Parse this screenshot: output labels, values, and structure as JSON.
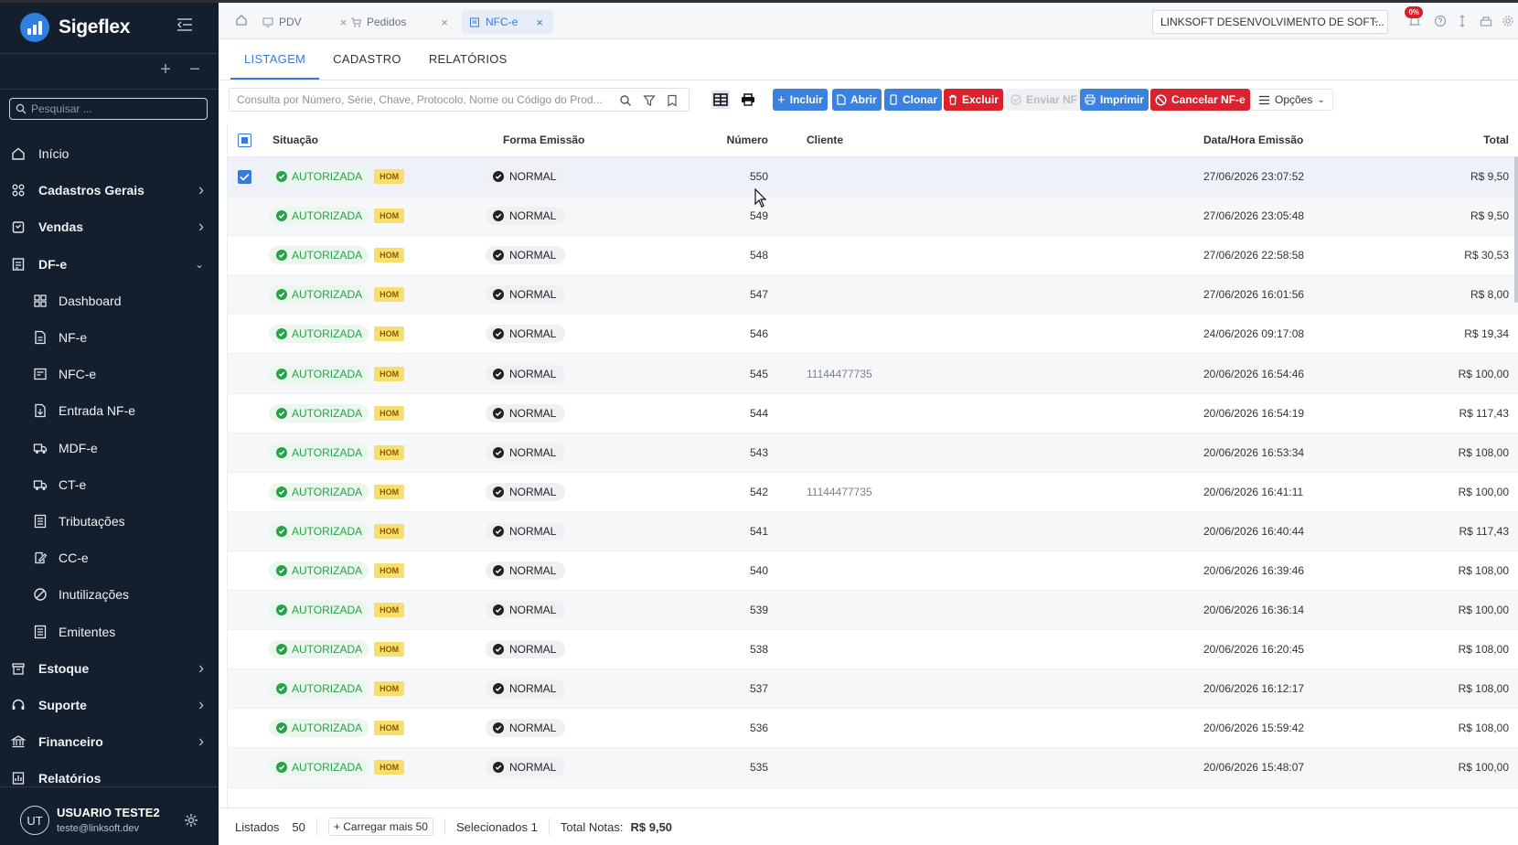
{
  "app": {
    "name": "Sigeflex"
  },
  "sidebar": {
    "search_placeholder": "Pesquisar ...",
    "items": [
      {
        "label": "Início",
        "icon": "home-icon",
        "level": "top",
        "chevron": ""
      },
      {
        "label": "Cadastros Gerais",
        "icon": "grid-icon",
        "level": "top",
        "chevron": "›"
      },
      {
        "label": "Vendas",
        "icon": "cart-icon",
        "level": "top",
        "chevron": "›"
      },
      {
        "label": "DF-e",
        "icon": "document-icon",
        "level": "top",
        "chevron": "⌄"
      },
      {
        "label": "Dashboard",
        "icon": "dashboard-icon",
        "level": "sub",
        "chevron": ""
      },
      {
        "label": "NF-e",
        "icon": "file-icon",
        "level": "sub",
        "chevron": ""
      },
      {
        "label": "NFC-e",
        "icon": "receipt-icon",
        "level": "sub",
        "chevron": ""
      },
      {
        "label": "Entrada NF-e",
        "icon": "file-in-icon",
        "level": "sub",
        "chevron": ""
      },
      {
        "label": "MDF-e",
        "icon": "truck-icon",
        "level": "sub",
        "chevron": ""
      },
      {
        "label": "CT-e",
        "icon": "truck-icon",
        "level": "sub",
        "chevron": ""
      },
      {
        "label": "Tributações",
        "icon": "tax-icon",
        "level": "sub",
        "chevron": ""
      },
      {
        "label": "CC-e",
        "icon": "edit-doc-icon",
        "level": "sub",
        "chevron": ""
      },
      {
        "label": "Inutilizações",
        "icon": "ban-icon",
        "level": "sub",
        "chevron": ""
      },
      {
        "label": "Emitentes",
        "icon": "list-icon",
        "level": "sub",
        "chevron": ""
      },
      {
        "label": "Estoque",
        "icon": "box-icon",
        "level": "top",
        "chevron": "›"
      },
      {
        "label": "Suporte",
        "icon": "headset-icon",
        "level": "top",
        "chevron": "›"
      },
      {
        "label": "Financeiro",
        "icon": "bank-icon",
        "level": "top",
        "chevron": "›"
      },
      {
        "label": "Relatórios",
        "icon": "report-icon",
        "level": "top",
        "chevron": ""
      }
    ],
    "user": {
      "initials": "UT",
      "name": "USUARIO TESTE2",
      "email": "teste@linksoft.dev"
    }
  },
  "topbar": {
    "tabs": [
      {
        "label": "PDV",
        "icon": "monitor-icon"
      },
      {
        "label": "Pedidos",
        "icon": "cart-icon"
      },
      {
        "label": "NFC-e",
        "icon": "receipt-icon"
      }
    ],
    "company": "LINKSOFT DESENVOLVIMENTO DE SOFT...",
    "notification_badge": "0%"
  },
  "subtabs": [
    "LISTAGEM",
    "CADASTRO",
    "RELATÓRIOS"
  ],
  "toolbar": {
    "search_placeholder": "Consulta por Número, Série, Chave, Protocolo, Nome ou Código do Prod...",
    "buttons": {
      "incluir": "Incluir",
      "abrir": "Abrir",
      "clonar": "Clonar",
      "excluir": "Excluir",
      "enviar": "Enviar NF",
      "imprimir": "Imprimir",
      "cancelar": "Cancelar NF-e",
      "opcoes": "Opções"
    }
  },
  "table": {
    "headers": {
      "situacao": "Situação",
      "forma": "Forma Emissão",
      "numero": "Número",
      "cliente": "Cliente",
      "data": "Data/Hora Emissão",
      "total": "Total"
    },
    "rows": [
      {
        "situacao": "AUTORIZADA",
        "env": "HOM",
        "forma": "NORMAL",
        "numero": "550",
        "cliente": "",
        "data": "27/06/2026 23:07:52",
        "total": "R$ 9,50"
      },
      {
        "situacao": "AUTORIZADA",
        "env": "HOM",
        "forma": "NORMAL",
        "numero": "549",
        "cliente": "",
        "data": "27/06/2026 23:05:48",
        "total": "R$ 9,50"
      },
      {
        "situacao": "AUTORIZADA",
        "env": "HOM",
        "forma": "NORMAL",
        "numero": "548",
        "cliente": "",
        "data": "27/06/2026 22:58:58",
        "total": "R$ 30,53"
      },
      {
        "situacao": "AUTORIZADA",
        "env": "HOM",
        "forma": "NORMAL",
        "numero": "547",
        "cliente": "",
        "data": "27/06/2026 16:01:56",
        "total": "R$ 8,00"
      },
      {
        "situacao": "AUTORIZADA",
        "env": "HOM",
        "forma": "NORMAL",
        "numero": "546",
        "cliente": "",
        "data": "24/06/2026 09:17:08",
        "total": "R$ 19,34"
      },
      {
        "situacao": "AUTORIZADA",
        "env": "HOM",
        "forma": "NORMAL",
        "numero": "545",
        "cliente": "11144477735",
        "data": "20/06/2026 16:54:46",
        "total": "R$ 100,00"
      },
      {
        "situacao": "AUTORIZADA",
        "env": "HOM",
        "forma": "NORMAL",
        "numero": "544",
        "cliente": "",
        "data": "20/06/2026 16:54:19",
        "total": "R$ 117,43"
      },
      {
        "situacao": "AUTORIZADA",
        "env": "HOM",
        "forma": "NORMAL",
        "numero": "543",
        "cliente": "",
        "data": "20/06/2026 16:53:34",
        "total": "R$ 108,00"
      },
      {
        "situacao": "AUTORIZADA",
        "env": "HOM",
        "forma": "NORMAL",
        "numero": "542",
        "cliente": "11144477735",
        "data": "20/06/2026 16:41:11",
        "total": "R$ 100,00"
      },
      {
        "situacao": "AUTORIZADA",
        "env": "HOM",
        "forma": "NORMAL",
        "numero": "541",
        "cliente": "",
        "data": "20/06/2026 16:40:44",
        "total": "R$ 117,43"
      },
      {
        "situacao": "AUTORIZADA",
        "env": "HOM",
        "forma": "NORMAL",
        "numero": "540",
        "cliente": "",
        "data": "20/06/2026 16:39:46",
        "total": "R$ 108,00"
      },
      {
        "situacao": "AUTORIZADA",
        "env": "HOM",
        "forma": "NORMAL",
        "numero": "539",
        "cliente": "",
        "data": "20/06/2026 16:36:14",
        "total": "R$ 100,00"
      },
      {
        "situacao": "AUTORIZADA",
        "env": "HOM",
        "forma": "NORMAL",
        "numero": "538",
        "cliente": "",
        "data": "20/06/2026 16:20:45",
        "total": "R$ 108,00"
      },
      {
        "situacao": "AUTORIZADA",
        "env": "HOM",
        "forma": "NORMAL",
        "numero": "537",
        "cliente": "",
        "data": "20/06/2026 16:12:17",
        "total": "R$ 108,00"
      },
      {
        "situacao": "AUTORIZADA",
        "env": "HOM",
        "forma": "NORMAL",
        "numero": "536",
        "cliente": "",
        "data": "20/06/2026 15:59:42",
        "total": "R$ 108,00"
      },
      {
        "situacao": "AUTORIZADA",
        "env": "HOM",
        "forma": "NORMAL",
        "numero": "535",
        "cliente": "",
        "data": "20/06/2026 15:48:07",
        "total": "R$ 100,00"
      }
    ],
    "selected_row": 0
  },
  "footer": {
    "listados_label": "Listados",
    "listados_value": "50",
    "carregar_label": "Carregar mais 50",
    "selecionados": "Selecionados 1",
    "total_label": "Total Notas:",
    "total_value": "R$ 9,50"
  },
  "colors": {
    "sidebar_bg": "#141f2e",
    "accent": "#3b79d8",
    "danger": "#d8232f",
    "success": "#26a248",
    "hom": "#f8de6c"
  }
}
